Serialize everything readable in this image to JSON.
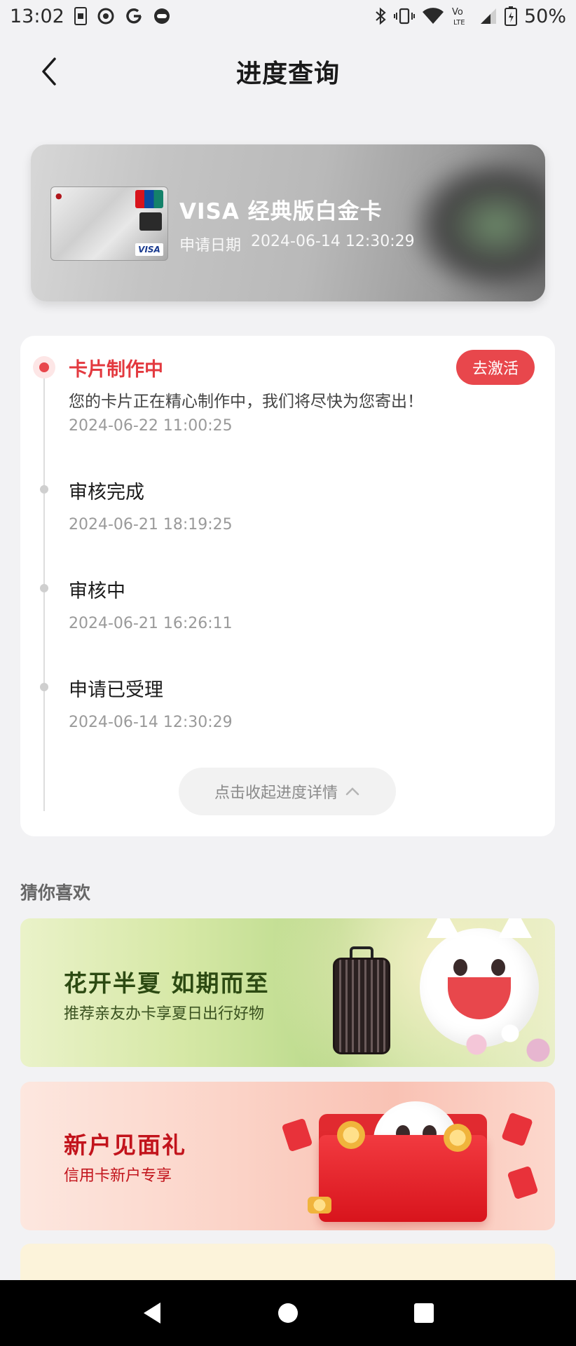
{
  "status_bar": {
    "time": "13:02",
    "battery": "50%",
    "icons_left": [
      "sim-icon",
      "sync-icon",
      "google-icon",
      "record-icon"
    ],
    "icons_right": [
      "bluetooth-icon",
      "vibrate-icon",
      "wifi-icon",
      "volte-icon",
      "signal-icon",
      "battery-icon"
    ],
    "volte_label": "LTE"
  },
  "header": {
    "title": "进度查询"
  },
  "card": {
    "name": "VISA 经典版白金卡",
    "date_label": "申请日期",
    "date_value": "2024-06-14 12:30:29"
  },
  "progress": {
    "steps": [
      {
        "title": "卡片制作中",
        "desc": "您的卡片正在精心制作中，我们将尽快为您寄出！",
        "time": "2024-06-22 11:00:25",
        "active": true
      },
      {
        "title": "审核完成",
        "time": "2024-06-21 18:19:25",
        "active": false
      },
      {
        "title": "审核中",
        "time": "2024-06-21 16:26:11",
        "active": false
      },
      {
        "title": "申请已受理",
        "time": "2024-06-14 12:30:29",
        "active": false
      }
    ],
    "activate_label": "去激活",
    "collapse_label": "点击收起进度详情"
  },
  "recommend": {
    "section_title": "猜你喜欢",
    "banners": [
      {
        "title": "花开半夏 如期而至",
        "subtitle": "推荐亲友办卡享夏日出行好物"
      },
      {
        "title": "新户见面礼",
        "subtitle": "信用卡新户专享"
      }
    ]
  },
  "colors": {
    "accent": "#e8474c",
    "page_bg": "#f2f2f4",
    "muted_text": "#9a9a9a"
  }
}
